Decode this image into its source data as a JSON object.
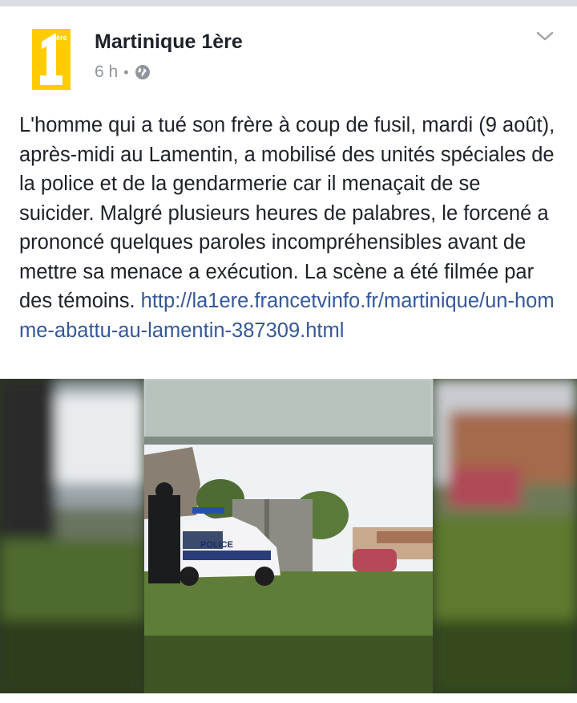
{
  "post": {
    "page_name": "Martinique 1ère",
    "time": "6 h",
    "separator": "•",
    "privacy_icon": "globe-icon",
    "menu_icon": "chevron-down-icon",
    "logo_icon": "france-1ere-logo",
    "text": "L'homme qui a tué son frère à coup de fusil, mardi (9 août), après-midi au Lamentin, a mobilisé des unités spéciales de la police et de la gendarmerie car il menaçait de se suicider. Malgré plusieurs heures de palabres, le forcené a prononcé quelques paroles incompréhensibles avant de mettre sa menace a exécution. La scène a été filmée par des témoins.",
    "link": "http://la1ere.francetvinfo.fr/martinique/un-homme-abattu-au-lamentin-387309.html",
    "media": {
      "alt": "video thumbnail: police car in a yard",
      "car_label": "POLICE"
    }
  },
  "colors": {
    "logo_yellow": "#ffcc00",
    "link": "#365899",
    "meta": "#90949c",
    "text": "#1d2129"
  }
}
